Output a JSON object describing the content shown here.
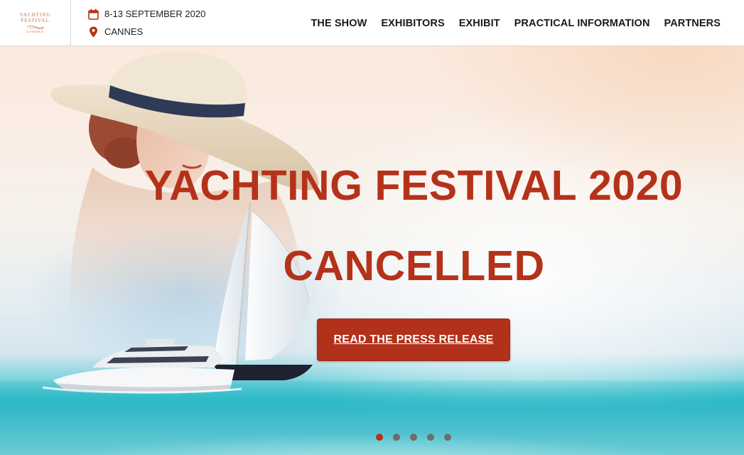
{
  "header": {
    "logo": {
      "line1": "YACHTING",
      "line2": "FESTIVAL",
      "line3": "CANNES"
    },
    "date": "8-13 SEPTEMBER 2020",
    "location": "CANNES",
    "icons": {
      "date": "calendar-icon",
      "location": "map-pin-icon"
    }
  },
  "nav": {
    "items": [
      {
        "label": "THE SHOW"
      },
      {
        "label": "EXHIBITORS"
      },
      {
        "label": "EXHIBIT"
      },
      {
        "label": "PRACTICAL INFORMATION"
      },
      {
        "label": "PARTNERS"
      }
    ]
  },
  "hero": {
    "title_line1": "YACHTING FESTIVAL 2020",
    "title_line2": "CANCELLED",
    "cta_label": "READ THE PRESS RELEASE",
    "slides_total": 5,
    "slide_active": 1
  },
  "colors": {
    "accent": "#b5321a",
    "button": "#b2311a",
    "logo": "#c1734f",
    "dot_inactive": "#6d6d6d"
  }
}
